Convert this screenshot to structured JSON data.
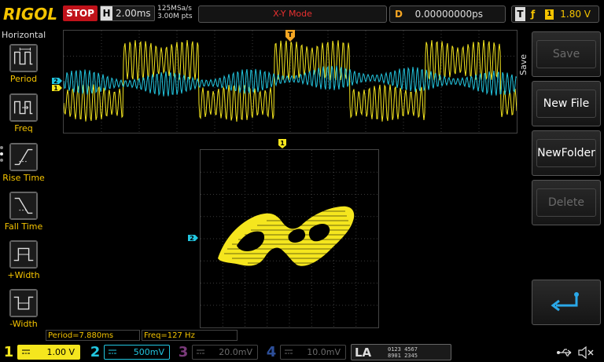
{
  "header": {
    "logo": "RIGOL",
    "run_state": "STOP",
    "timebase_letter": "H",
    "timebase": "2.00ms",
    "sample_rate": "125MSa/s",
    "memory_depth": "3.00M pts",
    "mode": "X-Y Mode",
    "delay_letter": "D",
    "delay": "0.00000000ps",
    "trigger_letter": "T",
    "trigger_edge": "ƒ",
    "trigger_source": "1",
    "trigger_level": "1.80 V"
  },
  "left_panel": {
    "title": "Horizontal",
    "items": [
      {
        "label": "Period",
        "icon": "period-icon"
      },
      {
        "label": "Freq",
        "icon": "freq-icon"
      },
      {
        "label": "Rise Time",
        "icon": "rise-time-icon"
      },
      {
        "label": "Fall Time",
        "icon": "fall-time-icon"
      },
      {
        "label": "+Width",
        "icon": "pos-width-icon"
      },
      {
        "label": "-Width",
        "icon": "neg-width-icon"
      }
    ]
  },
  "markers": {
    "trigger_position": "T",
    "ch1_marker": "1",
    "ch2_marker": "2",
    "xy_ch1_marker": "1",
    "xy_ch2_marker": "2"
  },
  "right_menu": {
    "tab": "Save",
    "buttons": [
      {
        "label": "Save",
        "enabled": false
      },
      {
        "label": "New File",
        "enabled": true
      },
      {
        "label": "NewFolder",
        "enabled": true
      },
      {
        "label": "Delete",
        "enabled": false
      },
      {
        "label": "",
        "icon": "return-arrow-icon",
        "enabled": true
      }
    ]
  },
  "measurements": {
    "period": "Period=7.880ms",
    "freq": "Freq=127 Hz"
  },
  "channels": [
    {
      "num": "1",
      "scale": "1.00 V",
      "color": "#f5e61e",
      "active": true
    },
    {
      "num": "2",
      "scale": "500mV",
      "color": "#22c6e0",
      "active": true
    },
    {
      "num": "3",
      "scale": "20.0mV",
      "color": "#c850c8",
      "active": false
    },
    {
      "num": "4",
      "scale": "10.0mV",
      "color": "#3a6ee8",
      "active": false
    }
  ],
  "la": {
    "label": "LA",
    "row1": "0123 4567",
    "row2": "8901 2345"
  },
  "status_icons": [
    "usb-icon",
    "speaker-muted-icon"
  ],
  "colors": {
    "ch1": "#f5e61e",
    "ch2": "#22c6e0",
    "ch3": "#c850c8",
    "ch4": "#3a6ee8",
    "stop": "#c0121a",
    "logo": "#f5c400",
    "delay": "#f5a623",
    "mode_text": "#e83030"
  }
}
